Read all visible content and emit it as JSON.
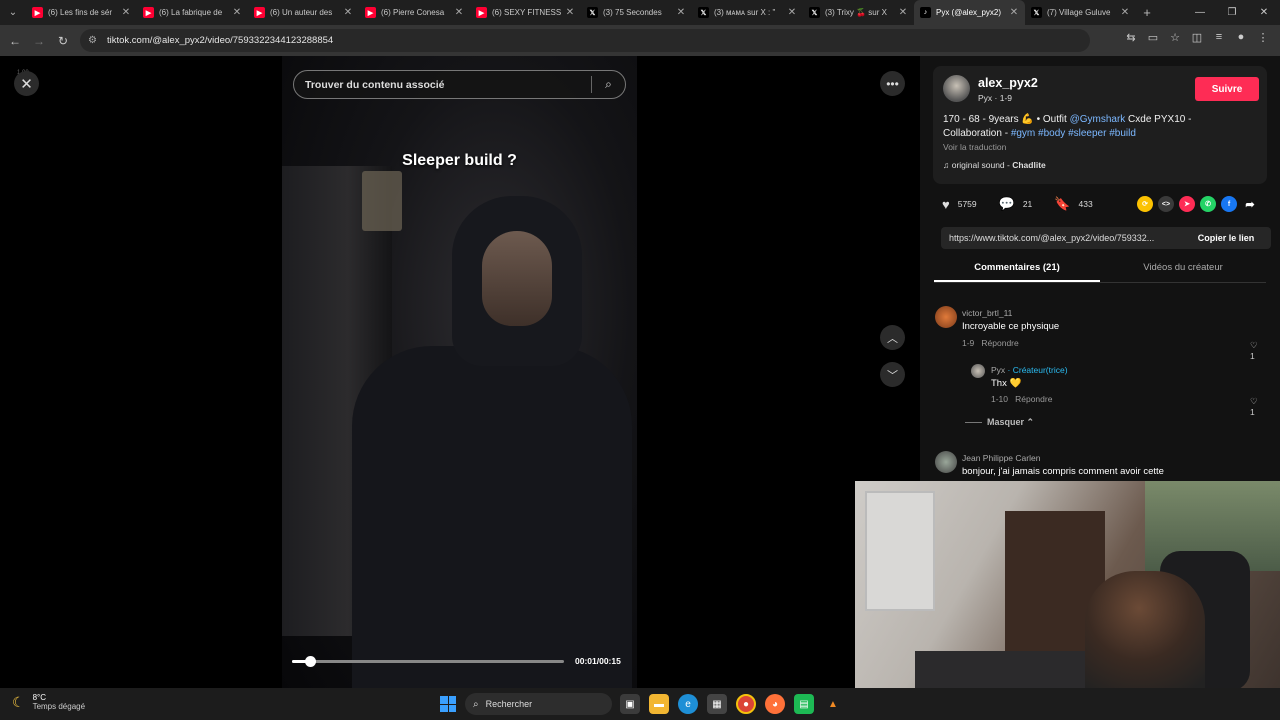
{
  "browser": {
    "tabs": [
      {
        "title": "(6) Les fins de sér",
        "icon": "youtube-icon",
        "color": "#ff0033"
      },
      {
        "title": "(6) La fabrique de",
        "icon": "youtube-icon",
        "color": "#ff0033"
      },
      {
        "title": "(6) Un auteur des",
        "icon": "youtube-icon",
        "color": "#ff0033"
      },
      {
        "title": "(6) Pierre Conesa",
        "icon": "youtube-icon",
        "color": "#ff0033"
      },
      {
        "title": "(6) SEXY FITNESS",
        "icon": "youtube-icon",
        "color": "#ff0033"
      },
      {
        "title": "(3) 75 Secondes",
        "icon": "x-icon",
        "color": "#000000"
      },
      {
        "title": "(3) ᴍᴀᴍᴀ sur X : \"",
        "icon": "x-icon",
        "color": "#000000"
      },
      {
        "title": "(3) Trixy 🍒 sur X",
        "icon": "x-icon",
        "color": "#000000"
      },
      {
        "title": "Pyx (@alex_pyx2)",
        "icon": "tiktok-icon",
        "color": "#000000",
        "active": true
      },
      {
        "title": "(7) Village Guluve",
        "icon": "x-icon",
        "color": "#000000"
      }
    ],
    "url": "tiktok.com/@alex_pyx2/video/7593322344123288854"
  },
  "video": {
    "search_placeholder": "Trouver du contenu associé",
    "caption": "Sleeper build ?",
    "time": "00:01/00:15",
    "progress_fraction": 0.0667,
    "badge": "1.00"
  },
  "creator": {
    "username": "alex_pyx2",
    "subtitle": "Pyx · 1-9",
    "follow_label": "Suivre",
    "description_pre": "170 - 68 - 9years 💪 • Outfit ",
    "mention": "@Gymshark",
    "description_mid": " Cxde PYX10 - Collaboration - ",
    "hashtags": "#gym #body #sleeper #build",
    "translate_label": "Voir la traduction",
    "sound_prefix": "♫ original sound - ",
    "sound_author": "Chadlite"
  },
  "actions": {
    "likes": "5759",
    "comments": "21",
    "saves": "433"
  },
  "share": {
    "link": "https://www.tiktok.com/@alex_pyx2/video/759332...",
    "copy_label": "Copier le lien"
  },
  "panel_tabs": {
    "comments": "Commentaires (21)",
    "videos": "Vidéos du créateur"
  },
  "comments": [
    {
      "name": "victor_brtl_11",
      "text": "Incroyable ce physique",
      "date": "1-9",
      "reply": "Répondre",
      "likes": "1"
    },
    {
      "name": "Pyx",
      "creator_label": "· Créateur(trice)",
      "text": "Thx 💛",
      "date": "1-10",
      "reply": "Répondre",
      "likes": "1"
    },
    {
      "name": "Jean Philippe Carlen",
      "text": "bonjour, j'ai jamais compris comment avoir cette"
    }
  ],
  "hide_label": "Masquer",
  "taskbar": {
    "temperature": "8°C",
    "weather": "Temps dégagé",
    "search_label": "Rechercher"
  }
}
